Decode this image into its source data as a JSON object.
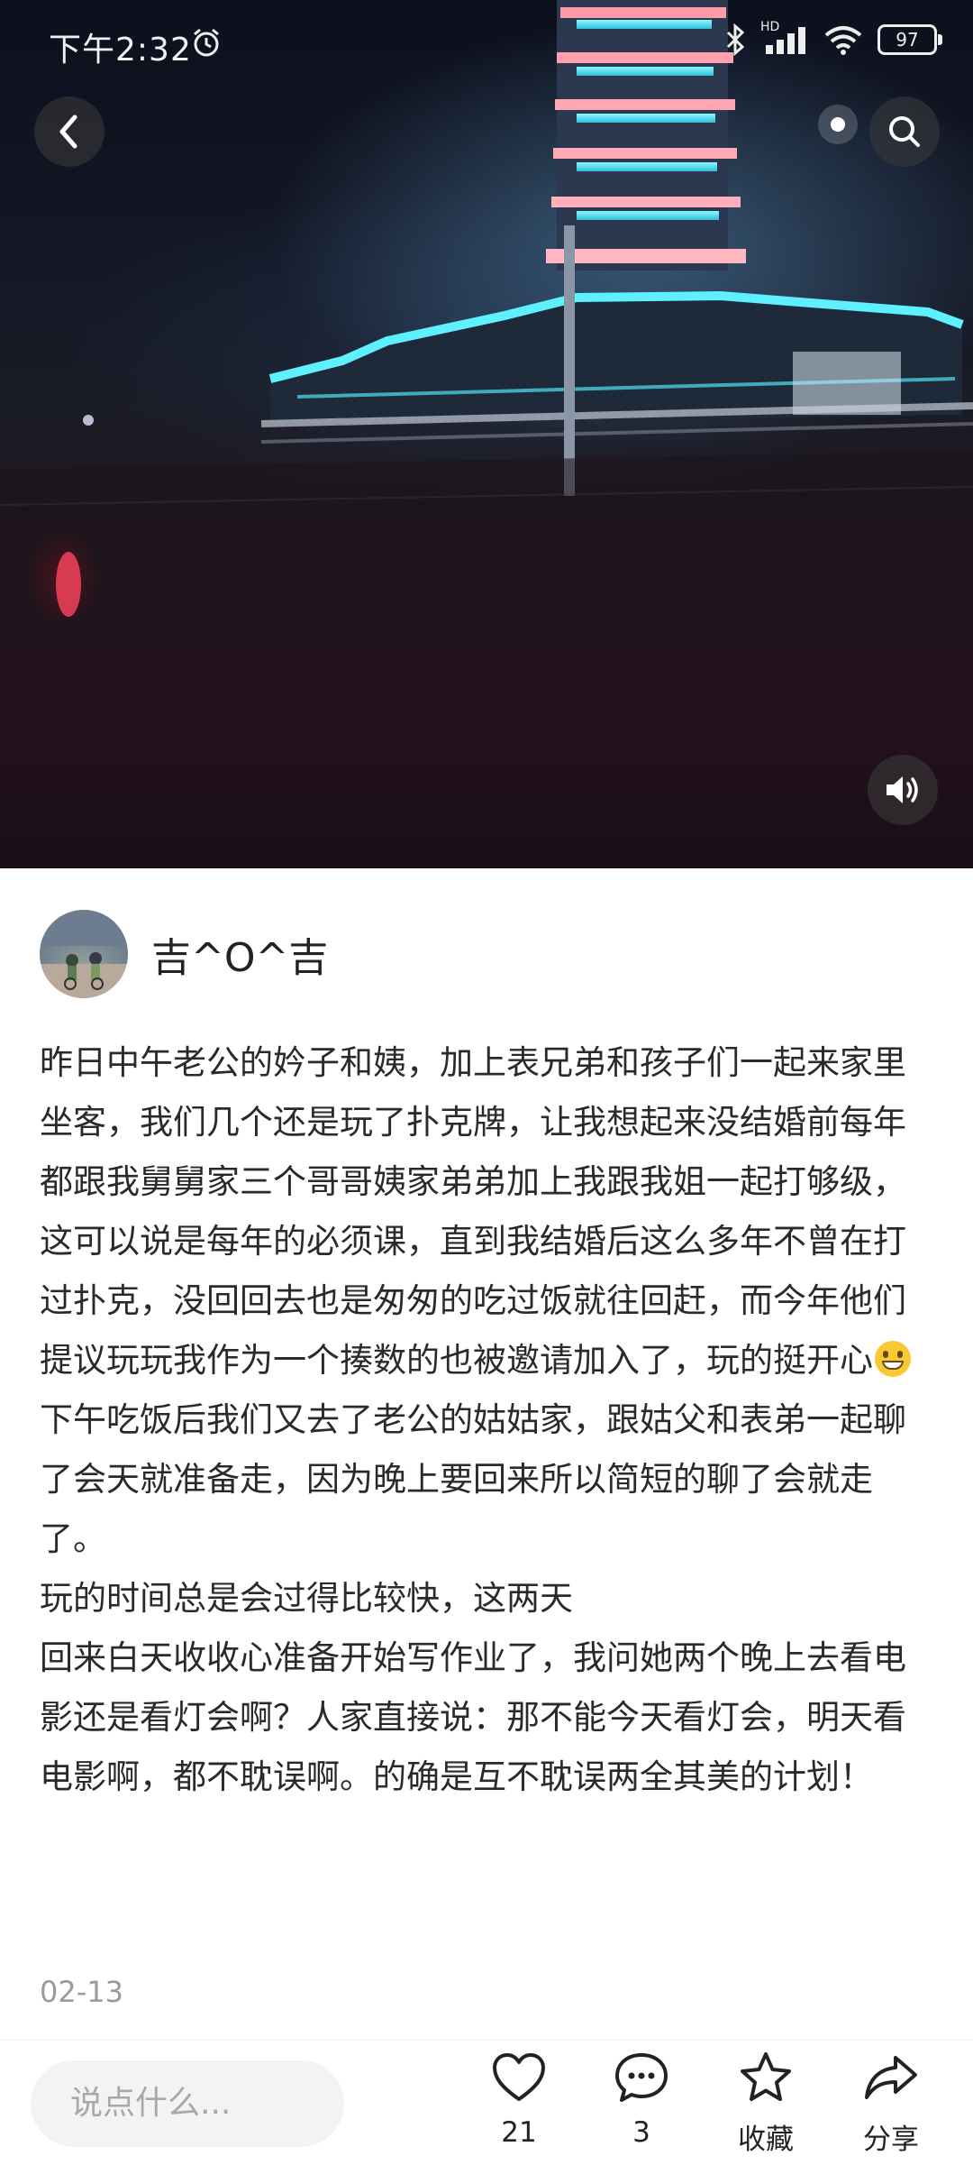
{
  "status_bar": {
    "time": "下午2:32",
    "network": "HD",
    "battery": "97"
  },
  "media": {
    "back_icon": "chevron-left-icon",
    "search_icon": "search-icon",
    "sound_icon": "speaker-icon"
  },
  "author": {
    "name": "吉^O^吉"
  },
  "post": {
    "paragraphs": [
      "昨日中午老公的妗子和姨，加上表兄弟和孩子们一起来家里坐客，我们几个还是玩了扑克牌，让我想起来没结婚前每年都跟我舅舅家三个哥哥姨家弟弟加上我跟我姐一起打够级，这可以说是每年的必须课，直到我结婚后这么多年不曾在打过扑克，没回回去也是匆匆的吃过饭就往回赶，而今年他们提议玩玩我作为一个揍数的也被邀请加入了，玩的挺开心",
      "下午吃饭后我们又去了老公的姑姑家，跟姑父和表弟一起聊了会天就准备走，因为晚上要回来所以简短的聊了会就走了。",
      "玩的时间总是会过得比较快，这两天",
      "回来白天收收心准备开始写作业了，我问她两个晚上去看电影还是看灯会啊？人家直接说：那不能今天看灯会，明天看电影啊，都不耽误啊。的确是互不耽误两全其美的计划！"
    ],
    "emoji": "grinning-face-emoji",
    "date": "02-13"
  },
  "bottom_bar": {
    "comment_placeholder": "说点什么...",
    "like_count": "21",
    "comment_count": "3",
    "favorite_label": "收藏",
    "share_label": "分享"
  }
}
